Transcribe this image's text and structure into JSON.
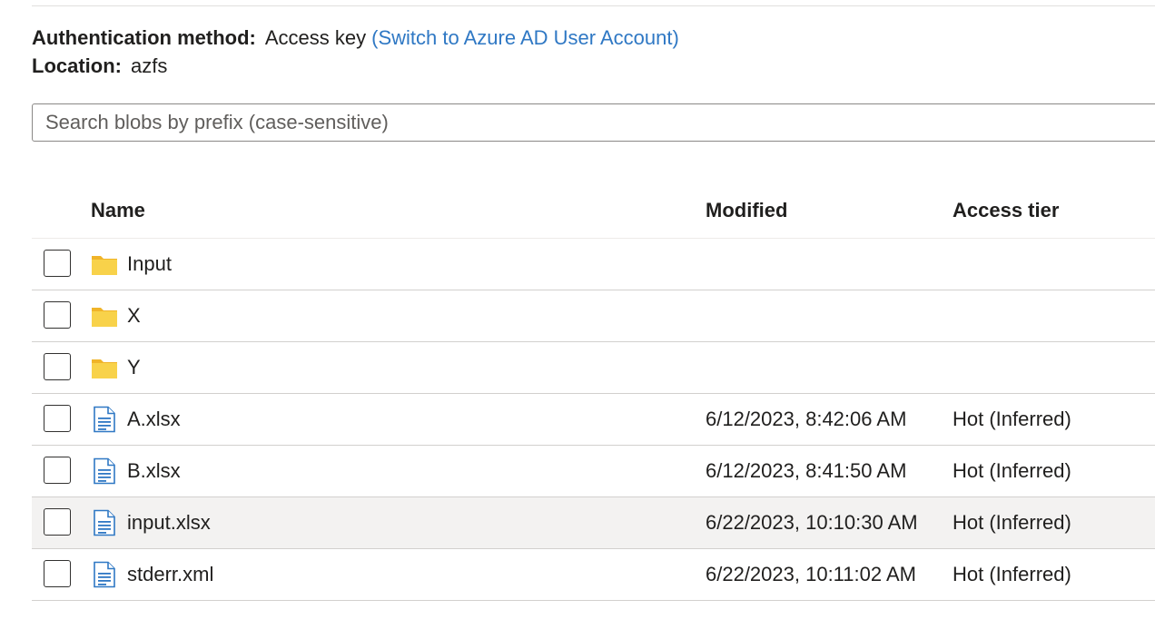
{
  "auth": {
    "label": "Authentication method:",
    "value": "Access key",
    "switch_link": "(Switch to Azure AD User Account)"
  },
  "location": {
    "label": "Location:",
    "value": "azfs"
  },
  "search": {
    "placeholder": "Search blobs by prefix (case-sensitive)",
    "value": ""
  },
  "columns": {
    "name": "Name",
    "modified": "Modified",
    "access_tier": "Access tier"
  },
  "rows": [
    {
      "name": "Input",
      "type": "folder",
      "modified": "",
      "access_tier": ""
    },
    {
      "name": "X",
      "type": "folder",
      "modified": "",
      "access_tier": ""
    },
    {
      "name": "Y",
      "type": "folder",
      "modified": "",
      "access_tier": ""
    },
    {
      "name": "A.xlsx",
      "type": "file",
      "modified": "6/12/2023, 8:42:06 AM",
      "access_tier": "Hot (Inferred)"
    },
    {
      "name": "B.xlsx",
      "type": "file",
      "modified": "6/12/2023, 8:41:50 AM",
      "access_tier": "Hot (Inferred)"
    },
    {
      "name": "input.xlsx",
      "type": "file",
      "modified": "6/22/2023, 10:10:30 AM",
      "access_tier": "Hot (Inferred)",
      "highlighted": true
    },
    {
      "name": "stderr.xml",
      "type": "file",
      "modified": "6/22/2023, 10:11:02 AM",
      "access_tier": "Hot (Inferred)"
    }
  ],
  "colors": {
    "link": "#2f78c4",
    "folder": "#f8d24a",
    "file_icon": "#2f78c4",
    "row_highlight": "#f3f2f1"
  },
  "icons": {
    "folder": "folder-icon",
    "file": "file-icon"
  }
}
